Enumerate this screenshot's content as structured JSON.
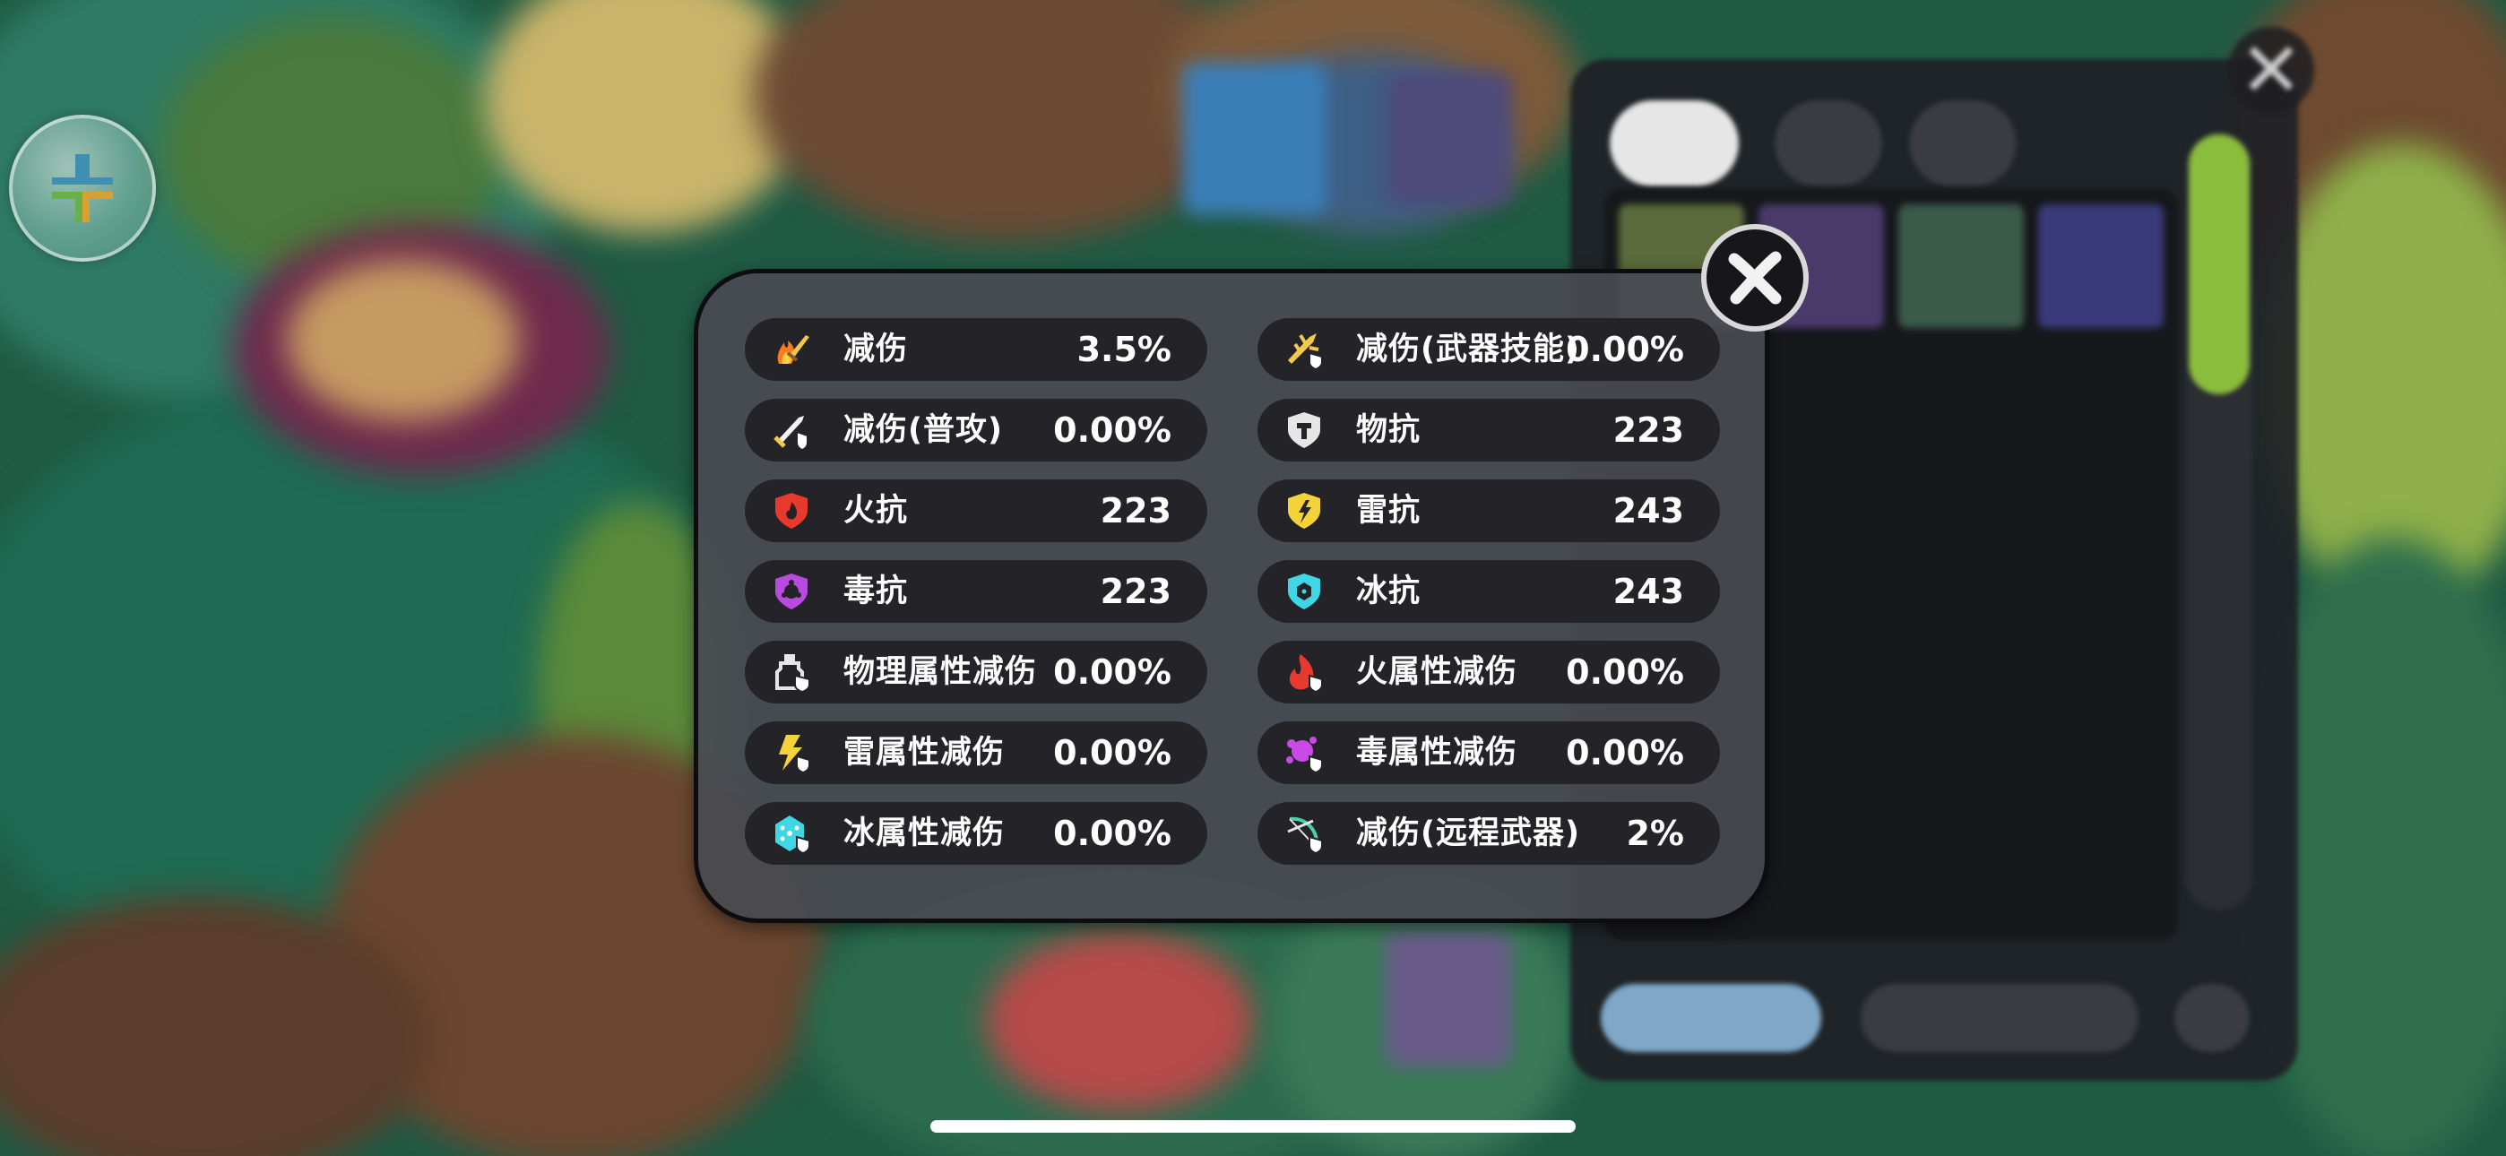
{
  "stats": {
    "left": [
      {
        "icon": "flame-sword-icon",
        "label": "减伤",
        "value": "3.5%"
      },
      {
        "icon": "sword-shield-icon",
        "label": "减伤(普攻)",
        "value": "0.00%"
      },
      {
        "icon": "fire-shield-icon",
        "label": "火抗",
        "value": "223"
      },
      {
        "icon": "poison-shield-icon",
        "label": "毒抗",
        "value": "223"
      },
      {
        "icon": "physical-bottle-icon",
        "label": "物理属性减伤",
        "value": "0.00%"
      },
      {
        "icon": "lightning-bolt-icon",
        "label": "雷属性减伤",
        "value": "0.00%"
      },
      {
        "icon": "ice-crystal-icon",
        "label": "冰属性减伤",
        "value": "0.00%"
      }
    ],
    "right": [
      {
        "icon": "weapon-skill-icon",
        "label": "减伤(武器技能)",
        "value": "0.00%"
      },
      {
        "icon": "physical-shield-icon",
        "label": "物抗",
        "value": "223"
      },
      {
        "icon": "lightning-shield-icon",
        "label": "雷抗",
        "value": "243"
      },
      {
        "icon": "ice-shield-icon",
        "label": "冰抗",
        "value": "243"
      },
      {
        "icon": "fire-flame-icon",
        "label": "火属性减伤",
        "value": "0.00%"
      },
      {
        "icon": "poison-splash-icon",
        "label": "毒属性减伤",
        "value": "0.00%"
      },
      {
        "icon": "bow-icon",
        "label": "减伤(远程武器)",
        "value": "2%"
      }
    ]
  },
  "colors": {
    "modal_bg": "#484a52",
    "row_bg": "#232328",
    "text": "#ffffff",
    "fire": "#e8392e",
    "lightning": "#f3d23a",
    "poison": "#b84ae0",
    "ice": "#3fd6e6",
    "physical": "#e6e6e6",
    "inventory_scroll": "#8bbd3c"
  }
}
